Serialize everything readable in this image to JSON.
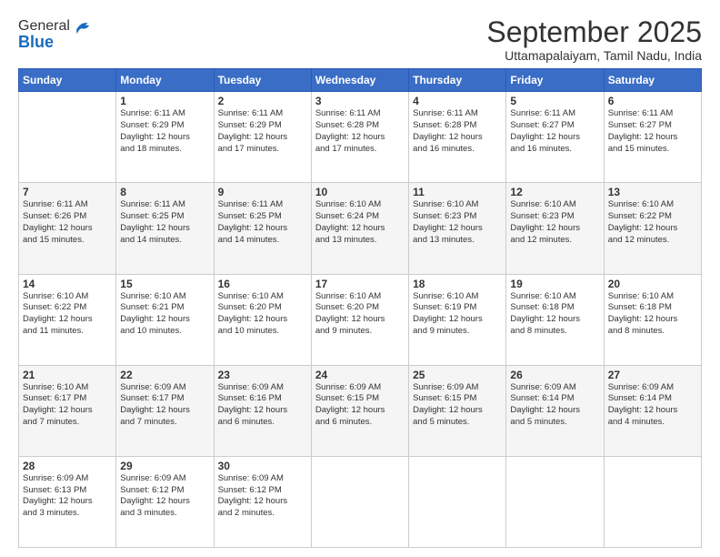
{
  "header": {
    "logo_line1": "General",
    "logo_line2": "Blue",
    "title": "September 2025",
    "subtitle": "Uttamapalaiyam, Tamil Nadu, India"
  },
  "days_of_week": [
    "Sunday",
    "Monday",
    "Tuesday",
    "Wednesday",
    "Thursday",
    "Friday",
    "Saturday"
  ],
  "weeks": [
    [
      {
        "day": "",
        "info": ""
      },
      {
        "day": "1",
        "info": "Sunrise: 6:11 AM\nSunset: 6:29 PM\nDaylight: 12 hours\nand 18 minutes."
      },
      {
        "day": "2",
        "info": "Sunrise: 6:11 AM\nSunset: 6:29 PM\nDaylight: 12 hours\nand 17 minutes."
      },
      {
        "day": "3",
        "info": "Sunrise: 6:11 AM\nSunset: 6:28 PM\nDaylight: 12 hours\nand 17 minutes."
      },
      {
        "day": "4",
        "info": "Sunrise: 6:11 AM\nSunset: 6:28 PM\nDaylight: 12 hours\nand 16 minutes."
      },
      {
        "day": "5",
        "info": "Sunrise: 6:11 AM\nSunset: 6:27 PM\nDaylight: 12 hours\nand 16 minutes."
      },
      {
        "day": "6",
        "info": "Sunrise: 6:11 AM\nSunset: 6:27 PM\nDaylight: 12 hours\nand 15 minutes."
      }
    ],
    [
      {
        "day": "7",
        "info": "Sunrise: 6:11 AM\nSunset: 6:26 PM\nDaylight: 12 hours\nand 15 minutes."
      },
      {
        "day": "8",
        "info": "Sunrise: 6:11 AM\nSunset: 6:25 PM\nDaylight: 12 hours\nand 14 minutes."
      },
      {
        "day": "9",
        "info": "Sunrise: 6:11 AM\nSunset: 6:25 PM\nDaylight: 12 hours\nand 14 minutes."
      },
      {
        "day": "10",
        "info": "Sunrise: 6:10 AM\nSunset: 6:24 PM\nDaylight: 12 hours\nand 13 minutes."
      },
      {
        "day": "11",
        "info": "Sunrise: 6:10 AM\nSunset: 6:23 PM\nDaylight: 12 hours\nand 13 minutes."
      },
      {
        "day": "12",
        "info": "Sunrise: 6:10 AM\nSunset: 6:23 PM\nDaylight: 12 hours\nand 12 minutes."
      },
      {
        "day": "13",
        "info": "Sunrise: 6:10 AM\nSunset: 6:22 PM\nDaylight: 12 hours\nand 12 minutes."
      }
    ],
    [
      {
        "day": "14",
        "info": "Sunrise: 6:10 AM\nSunset: 6:22 PM\nDaylight: 12 hours\nand 11 minutes."
      },
      {
        "day": "15",
        "info": "Sunrise: 6:10 AM\nSunset: 6:21 PM\nDaylight: 12 hours\nand 10 minutes."
      },
      {
        "day": "16",
        "info": "Sunrise: 6:10 AM\nSunset: 6:20 PM\nDaylight: 12 hours\nand 10 minutes."
      },
      {
        "day": "17",
        "info": "Sunrise: 6:10 AM\nSunset: 6:20 PM\nDaylight: 12 hours\nand 9 minutes."
      },
      {
        "day": "18",
        "info": "Sunrise: 6:10 AM\nSunset: 6:19 PM\nDaylight: 12 hours\nand 9 minutes."
      },
      {
        "day": "19",
        "info": "Sunrise: 6:10 AM\nSunset: 6:18 PM\nDaylight: 12 hours\nand 8 minutes."
      },
      {
        "day": "20",
        "info": "Sunrise: 6:10 AM\nSunset: 6:18 PM\nDaylight: 12 hours\nand 8 minutes."
      }
    ],
    [
      {
        "day": "21",
        "info": "Sunrise: 6:10 AM\nSunset: 6:17 PM\nDaylight: 12 hours\nand 7 minutes."
      },
      {
        "day": "22",
        "info": "Sunrise: 6:09 AM\nSunset: 6:17 PM\nDaylight: 12 hours\nand 7 minutes."
      },
      {
        "day": "23",
        "info": "Sunrise: 6:09 AM\nSunset: 6:16 PM\nDaylight: 12 hours\nand 6 minutes."
      },
      {
        "day": "24",
        "info": "Sunrise: 6:09 AM\nSunset: 6:15 PM\nDaylight: 12 hours\nand 6 minutes."
      },
      {
        "day": "25",
        "info": "Sunrise: 6:09 AM\nSunset: 6:15 PM\nDaylight: 12 hours\nand 5 minutes."
      },
      {
        "day": "26",
        "info": "Sunrise: 6:09 AM\nSunset: 6:14 PM\nDaylight: 12 hours\nand 5 minutes."
      },
      {
        "day": "27",
        "info": "Sunrise: 6:09 AM\nSunset: 6:14 PM\nDaylight: 12 hours\nand 4 minutes."
      }
    ],
    [
      {
        "day": "28",
        "info": "Sunrise: 6:09 AM\nSunset: 6:13 PM\nDaylight: 12 hours\nand 3 minutes."
      },
      {
        "day": "29",
        "info": "Sunrise: 6:09 AM\nSunset: 6:12 PM\nDaylight: 12 hours\nand 3 minutes."
      },
      {
        "day": "30",
        "info": "Sunrise: 6:09 AM\nSunset: 6:12 PM\nDaylight: 12 hours\nand 2 minutes."
      },
      {
        "day": "",
        "info": ""
      },
      {
        "day": "",
        "info": ""
      },
      {
        "day": "",
        "info": ""
      },
      {
        "day": "",
        "info": ""
      }
    ]
  ]
}
